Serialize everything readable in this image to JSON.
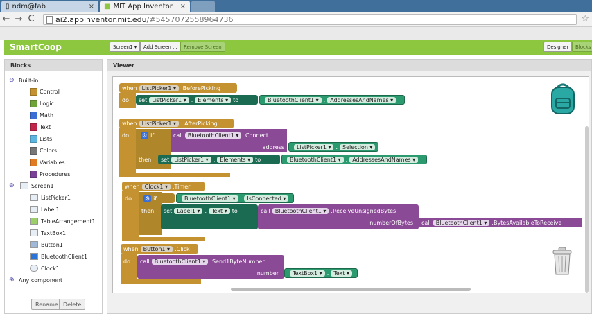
{
  "browser": {
    "tabs": [
      {
        "title": "ndm@fab"
      },
      {
        "title": "MIT App Inventor"
      }
    ],
    "url_host": "ai2.appinventor.mit.edu",
    "url_path": "/#5457072558964736"
  },
  "app": {
    "project_name": "SmartCoop",
    "screen_select": "Screen1 ▾",
    "add_screen": "Add Screen ...",
    "remove_screen": "Remove Screen",
    "designer": "Designer",
    "blocks": "Blocks"
  },
  "blocks_panel": {
    "header": "Blocks",
    "builtin_label": "Built-in",
    "builtin": [
      {
        "label": "Control",
        "color": "#c49230"
      },
      {
        "label": "Logic",
        "color": "#6fa33a"
      },
      {
        "label": "Math",
        "color": "#3a6fd6"
      },
      {
        "label": "Text",
        "color": "#c0264a"
      },
      {
        "label": "Lists",
        "color": "#5db6e0"
      },
      {
        "label": "Colors",
        "color": "#777777"
      },
      {
        "label": "Variables",
        "color": "#e07a23"
      },
      {
        "label": "Procedures",
        "color": "#7a3f96"
      }
    ],
    "screen_label": "Screen1",
    "components": [
      "ListPicker1",
      "Label1",
      "TableArrangement1",
      "TextBox1",
      "Button1",
      "BluetoothClient1",
      "Clock1"
    ],
    "any_component": "Any component",
    "rename": "Rename",
    "delete": "Delete"
  },
  "viewer": {
    "header": "Viewer",
    "words": {
      "when": "when",
      "do": "do",
      "set": "set",
      "to": "to",
      "call": "call",
      "if": "if",
      "then": "then",
      "address": "address",
      "numberOfBytes": "numberOfBytes",
      "number": "number",
      "dot": "."
    },
    "b1": {
      "comp": "ListPicker1 ▾",
      "event": ".BeforePicking",
      "set_comp": "ListPicker1 ▾",
      "set_prop": "Elements ▾",
      "get_comp": "BluetoothClient1 ▾",
      "get_prop": "AddressesAndNames ▾"
    },
    "b2": {
      "comp": "ListPicker1 ▾",
      "event": ".AfterPicking",
      "call_comp": "BluetoothClient1 ▾",
      "method": ".Connect",
      "arg_comp": "ListPicker1 ▾",
      "arg_prop": "Selection ▾",
      "set_comp": "ListPicker1 ▾",
      "set_prop": "Elements ▾",
      "get_comp": "BluetoothClient1 ▾",
      "get_prop": "AddressesAndNames ▾"
    },
    "b3": {
      "comp": "Clock1 ▾",
      "event": ".Timer",
      "cond_comp": "BluetoothClient1 ▾",
      "cond_prop": "IsConnected ▾",
      "set_comp": "Label1 ▾",
      "set_prop": "Text ▾",
      "call_comp": "BluetoothClient1 ▾",
      "method": ".ReceiveUnsignedBytes",
      "arg_comp": "BluetoothClient1 ▾",
      "arg_method": ".BytesAvailableToReceive"
    },
    "b4": {
      "comp": "Button1 ▾",
      "event": ".Click",
      "call_comp": "BluetoothClient1 ▾",
      "method": ".Send1ByteNumber",
      "arg_comp": "TextBox1 ▾",
      "arg_prop": "Text ▾"
    }
  }
}
